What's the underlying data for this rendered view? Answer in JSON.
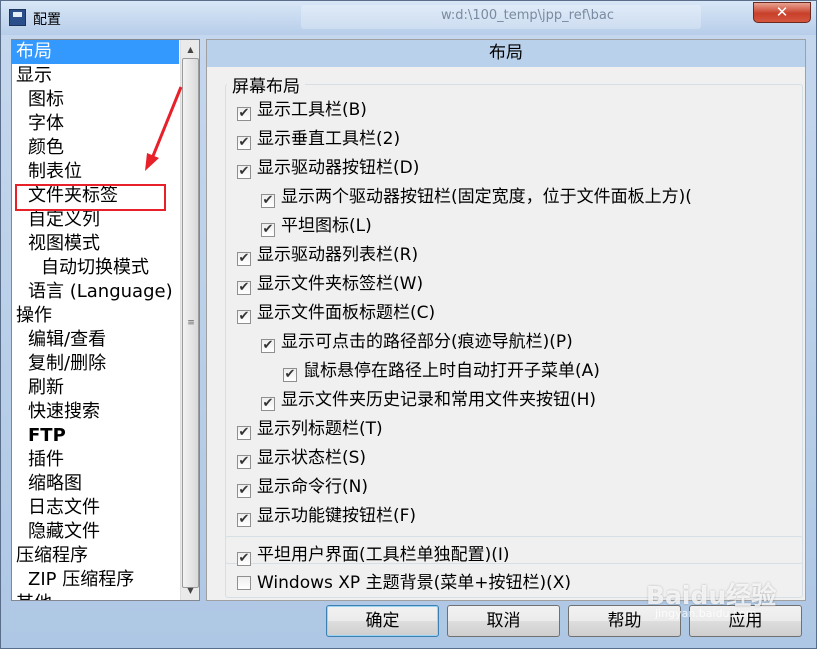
{
  "window": {
    "title": "配置",
    "background_path": "w:d:\\100_temp\\jpp_ref\\bac",
    "close_glyph": "✕"
  },
  "tree": {
    "items": [
      {
        "label": "布局",
        "level": 0,
        "selected": true
      },
      {
        "label": "显示",
        "level": 0
      },
      {
        "label": "图标",
        "level": 1
      },
      {
        "label": "字体",
        "level": 1
      },
      {
        "label": "颜色",
        "level": 1
      },
      {
        "label": "制表位",
        "level": 1
      },
      {
        "label": "文件夹标签",
        "level": 1
      },
      {
        "label": "自定义列",
        "level": 1
      },
      {
        "label": "视图模式",
        "level": 1
      },
      {
        "label": "自动切换模式",
        "level": 2
      },
      {
        "label": "语言 (Language)",
        "level": 1
      },
      {
        "label": "操作",
        "level": 0
      },
      {
        "label": "编辑/查看",
        "level": 1
      },
      {
        "label": "复制/删除",
        "level": 1
      },
      {
        "label": "刷新",
        "level": 1
      },
      {
        "label": "快速搜索",
        "level": 1
      },
      {
        "label": "FTP",
        "level": 1,
        "bold": true
      },
      {
        "label": "插件",
        "level": 1
      },
      {
        "label": "缩略图",
        "level": 1
      },
      {
        "label": "日志文件",
        "level": 1
      },
      {
        "label": "隐藏文件",
        "level": 1
      },
      {
        "label": "压缩程序",
        "level": 0
      },
      {
        "label": "ZIP 压缩程序",
        "level": 1
      },
      {
        "label": "其他",
        "level": 0
      }
    ]
  },
  "panel": {
    "header": "布局",
    "group_title": "屏幕布局",
    "options": [
      {
        "label": "显示工具栏(B)",
        "checked": true,
        "indent": 0
      },
      {
        "label": "显示垂直工具栏(2)",
        "checked": true,
        "indent": 0
      },
      {
        "label": "显示驱动器按钮栏(D)",
        "checked": true,
        "indent": 0
      },
      {
        "label": "显示两个驱动器按钮栏(固定宽度，位于文件面板上方)(",
        "checked": true,
        "indent": 1
      },
      {
        "label": "平坦图标(L)",
        "checked": true,
        "indent": 1
      },
      {
        "label": "显示驱动器列表栏(R)",
        "checked": true,
        "indent": 0
      },
      {
        "label": "显示文件夹标签栏(W)",
        "checked": true,
        "indent": 0
      },
      {
        "label": "显示文件面板标题栏(C)",
        "checked": true,
        "indent": 0
      },
      {
        "label": "显示可点击的路径部分(痕迹导航栏)(P)",
        "checked": true,
        "indent": 1
      },
      {
        "label": "鼠标悬停在路径上时自动打开子菜单(A)",
        "checked": true,
        "indent": 2
      },
      {
        "label": "显示文件夹历史记录和常用文件夹按钮(H)",
        "checked": true,
        "indent": 1
      },
      {
        "label": "显示列标题栏(T)",
        "checked": true,
        "indent": 0
      },
      {
        "label": "显示状态栏(S)",
        "checked": true,
        "indent": 0
      },
      {
        "label": "显示命令行(N)",
        "checked": true,
        "indent": 0
      },
      {
        "label": "显示功能键按钮栏(F)",
        "checked": true,
        "indent": 0
      }
    ],
    "options2": [
      {
        "label": "平坦用户界面(工具栏单独配置)(I)",
        "checked": true
      },
      {
        "label": "Windows XP 主题背景(菜单+按钮栏)(X)",
        "checked": false
      }
    ]
  },
  "buttons": {
    "ok": "确定",
    "cancel": "取消",
    "help": "帮助",
    "apply": "应用"
  },
  "watermark": {
    "text": "Baidu经验",
    "sub": "jingyan.baidu.com"
  },
  "colors": {
    "selection": "#3399ff",
    "annotation": "#e8202a",
    "header_bg": "#b9d1ea"
  }
}
